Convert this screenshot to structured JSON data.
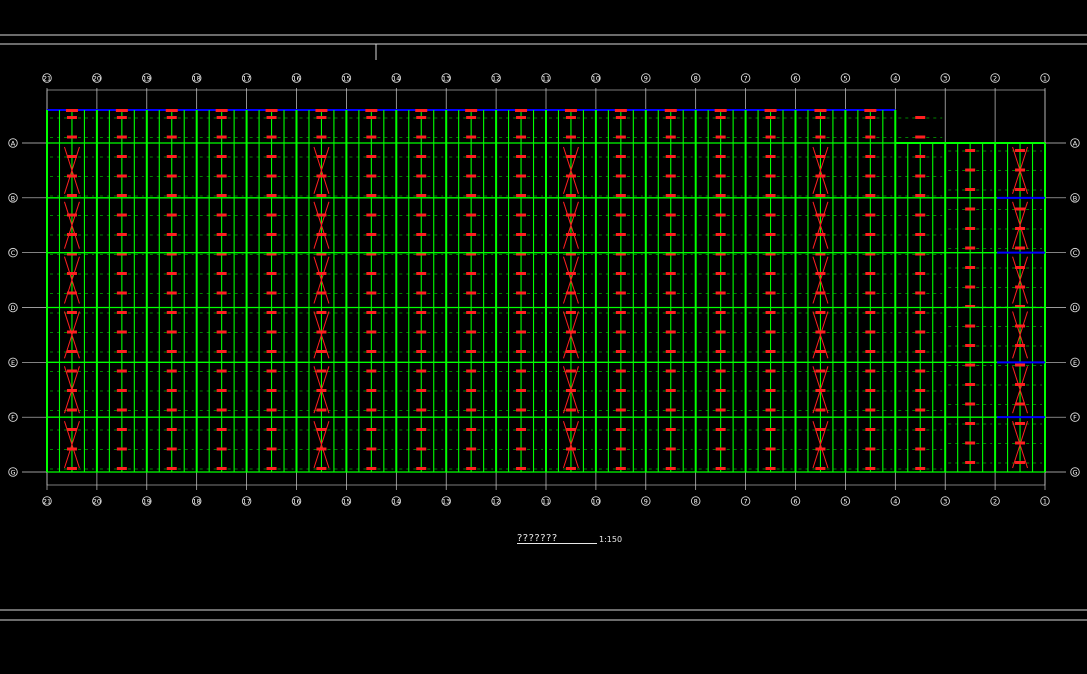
{
  "drawing": {
    "title": "???????",
    "scale": "1:150",
    "column_axes": [
      "21",
      "20",
      "19",
      "18",
      "17",
      "16",
      "15",
      "14",
      "13",
      "12",
      "11",
      "10",
      "9",
      "8",
      "7",
      "6",
      "5",
      "4",
      "3",
      "2",
      "1"
    ],
    "row_axes": [
      "A",
      "B",
      "C",
      "D",
      "E",
      "F",
      "G"
    ],
    "colors": {
      "background": "#000000",
      "frame": "#d8d8d8",
      "grid": "#cfcfcf",
      "purlin": "#00ff00",
      "label": "#ff2020",
      "edge": "#0000ff"
    }
  }
}
